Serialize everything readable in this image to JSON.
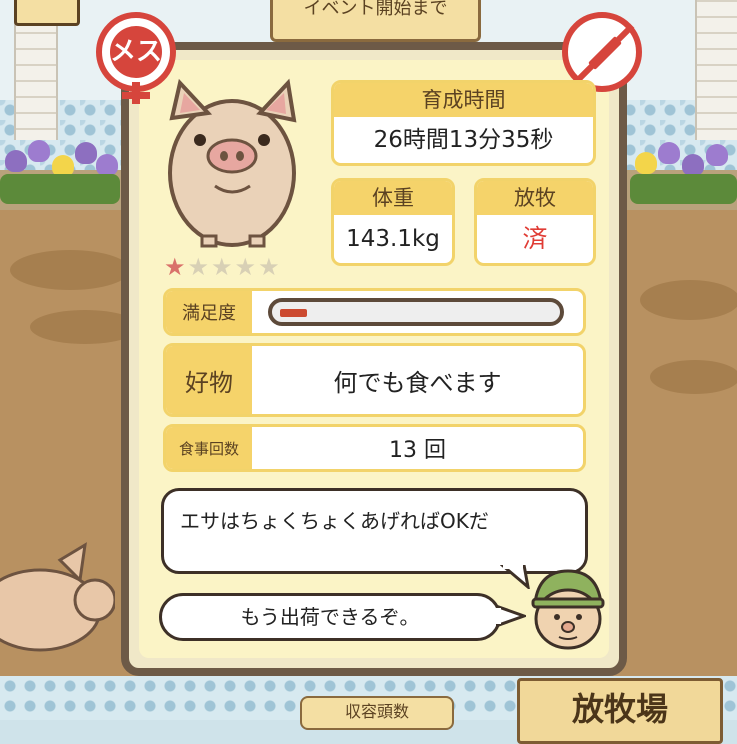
{
  "background": {
    "top_sign": "イベント開始まで",
    "bottom_sign": "放牧場",
    "bottom_sign2": "収容頭数"
  },
  "pig": {
    "gender_badge": "メス",
    "stars_on": "★",
    "stars_off": "★★★★",
    "rating_stars": 1,
    "rating_max": 5
  },
  "stats": {
    "time_label": "育成時間",
    "time_value": "26時間13分35秒",
    "weight_label": "体重",
    "weight_value": "143.1kg",
    "pasture_label": "放牧",
    "pasture_value": "済"
  },
  "satisfaction": {
    "label": "満足度",
    "level": 0.1
  },
  "favorite": {
    "label": "好物",
    "value": "何でも食べます"
  },
  "meals": {
    "label": "食事回数",
    "value": "13 回"
  },
  "dialog": {
    "line1": "エサはちょくちょくあげればOKだ",
    "line2": "もう出荷できるぞ。"
  },
  "colors": {
    "accent": "#f5d36a",
    "alert": "#d6453c",
    "frame": "#6d5a47",
    "card": "#fbf4c6"
  }
}
